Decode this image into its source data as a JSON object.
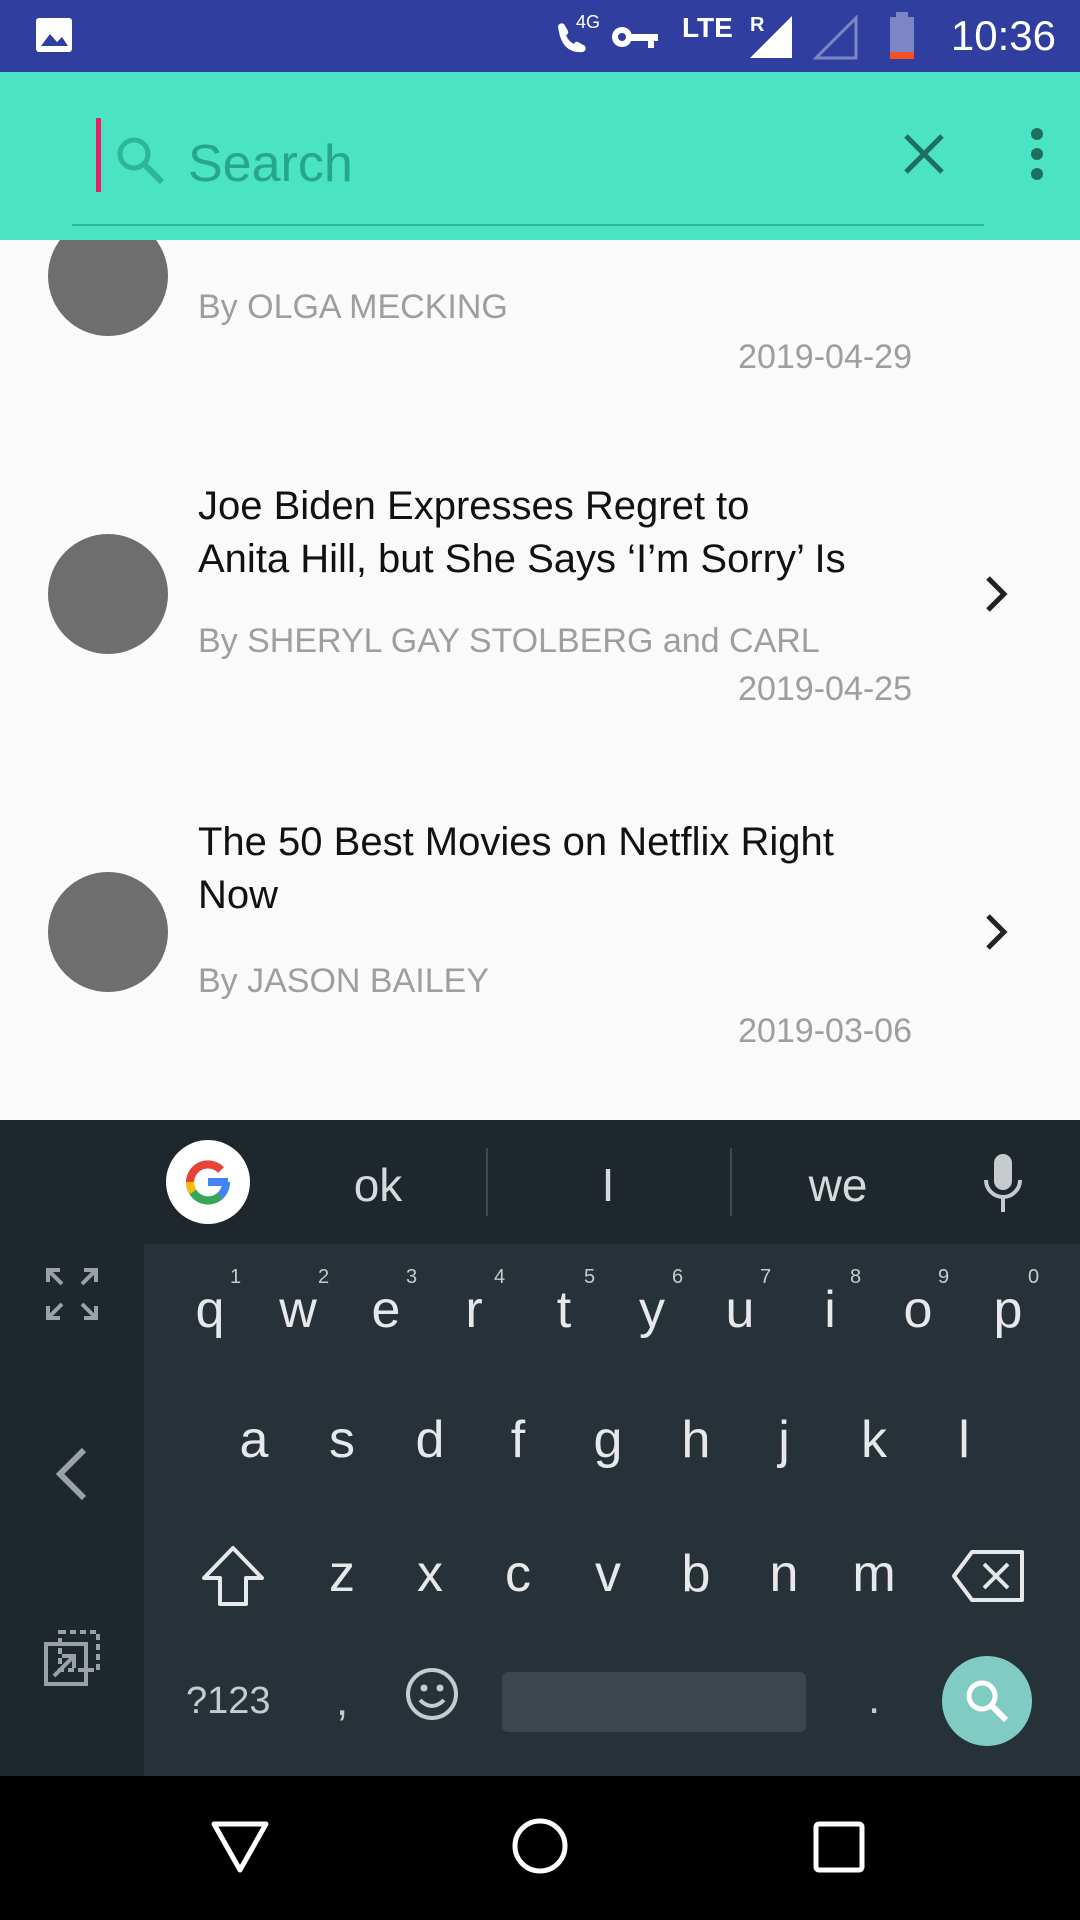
{
  "status_bar": {
    "time": "10:36",
    "network": "LTE",
    "roaming": "R",
    "call_badge": "4G"
  },
  "search": {
    "placeholder": "Search"
  },
  "articles": [
    {
      "title": "",
      "author": "By OLGA MECKING",
      "date": "2019-04-29"
    },
    {
      "title_line1": "Joe Biden Expresses Regret to",
      "title_line2": "Anita Hill, but She Says ‘I’m Sorry’ Is",
      "author": "By SHERYL GAY STOLBERG and CARL",
      "date": "2019-04-25"
    },
    {
      "title_line1": "The 50 Best Movies on Netflix Right",
      "title_line2": "Now",
      "author": "By JASON BAILEY",
      "date": "2019-03-06"
    }
  ],
  "keyboard": {
    "suggestions": [
      "ok",
      "I",
      "we"
    ],
    "row1": [
      "q",
      "w",
      "e",
      "r",
      "t",
      "y",
      "u",
      "i",
      "o",
      "p"
    ],
    "row1_numbers": [
      "1",
      "2",
      "3",
      "4",
      "5",
      "6",
      "7",
      "8",
      "9",
      "0"
    ],
    "row2": [
      "a",
      "s",
      "d",
      "f",
      "g",
      "h",
      "j",
      "k",
      "l"
    ],
    "row3": [
      "z",
      "x",
      "c",
      "v",
      "b",
      "n",
      "m"
    ],
    "symbols_key": "?123",
    "comma_key": ",",
    "period_key": ".",
    "accent_color": "#80cbc4"
  },
  "icons": [
    "gallery-icon",
    "wifi-call-icon",
    "vpn-key-icon",
    "signal-icon",
    "battery-icon",
    "search-icon",
    "close-icon",
    "overflow-menu-icon",
    "chevron-right-icon",
    "google-icon",
    "mic-icon",
    "expand-icon",
    "back-arrow-icon",
    "floating-keyboard-icon",
    "shift-icon",
    "backspace-icon",
    "emoji-icon",
    "nav-back-icon",
    "nav-home-icon",
    "nav-recents-icon"
  ]
}
